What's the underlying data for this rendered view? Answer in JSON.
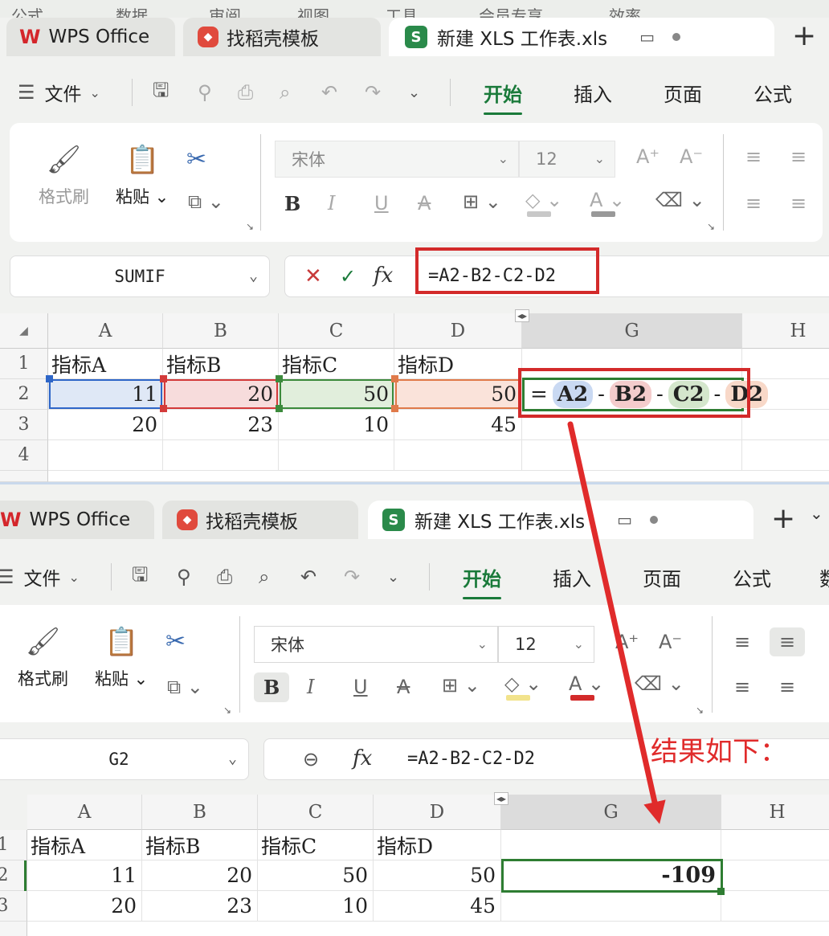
{
  "menu_strip": [
    "公式",
    "数据",
    "审阅",
    "视图",
    "工具",
    "会员专享",
    "效率"
  ],
  "app": {
    "name": "WPS Office"
  },
  "tabs": {
    "template": "找稻壳模板",
    "doc": "新建 XLS 工作表.xls",
    "doc_icon": "S",
    "plus": "+",
    "more": "⌄"
  },
  "toolbar": {
    "file": "文件",
    "ribbon_tabs": [
      "开始",
      "插入",
      "页面",
      "公式"
    ],
    "ribbon_tab_partial": "数"
  },
  "ribbon": {
    "format_painter": "格式刷",
    "paste": "粘贴",
    "font_name": "宋体",
    "font_size": "12",
    "bold": "B",
    "italic": "I",
    "underline": "U",
    "strike": "A",
    "colors": {
      "fill": "#f2e38c",
      "font_top": "#999999",
      "font_bottom": "#d32a2a"
    }
  },
  "screen1": {
    "namebox": "SUMIF",
    "formula": "=A2-B2-C2-D2",
    "columns": [
      "A",
      "B",
      "C",
      "D",
      "G",
      "H"
    ],
    "rows": [
      "1",
      "2",
      "3",
      "4"
    ],
    "headers": [
      "指标A",
      "指标B",
      "指标C",
      "指标D"
    ],
    "row2": [
      "11",
      "20",
      "50",
      "50"
    ],
    "row3": [
      "20",
      "23",
      "10",
      "45"
    ],
    "g2_tokens": {
      "eq": "=",
      "a": "A2",
      "b": "B2",
      "c": "C2",
      "d": "D2",
      "op": "-"
    },
    "ref_colors": {
      "a": "#2e66c8",
      "b": "#d33a3a",
      "c": "#3c8a3c",
      "d": "#e07a4a"
    }
  },
  "screen2": {
    "namebox": "G2",
    "formula": "=A2-B2-C2-D2",
    "columns": [
      "A",
      "B",
      "C",
      "D",
      "G",
      "H"
    ],
    "rows": [
      "1",
      "2",
      "3"
    ],
    "headers": [
      "指标A",
      "指标B",
      "指标C",
      "指标D"
    ],
    "row2": [
      "11",
      "20",
      "50",
      "50"
    ],
    "row3": [
      "20",
      "23",
      "10",
      "45"
    ],
    "g2_result": "-109"
  },
  "annotation": {
    "text": "结果如下：",
    "color": "#e02b2b"
  }
}
